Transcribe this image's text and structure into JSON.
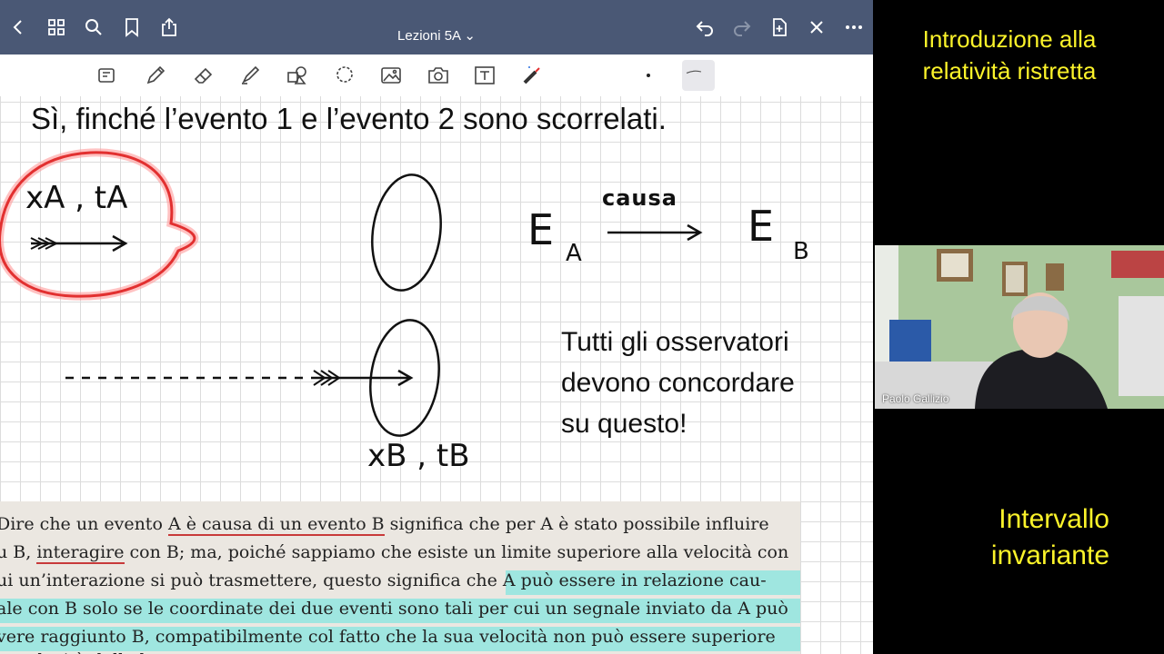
{
  "app": {
    "doc_title": "Lezioni 5A ⌄",
    "topbar_icons": [
      "back-icon",
      "grid-icon",
      "search-icon",
      "bookmark-icon",
      "share-icon",
      "undo-icon",
      "redo-icon",
      "add-page-icon",
      "close-icon",
      "more-icon"
    ],
    "tools": [
      "keyboard-icon",
      "pen-icon",
      "eraser-icon",
      "highlighter-icon",
      "shapes-icon",
      "lasso-icon",
      "image-icon",
      "camera-icon",
      "text-icon",
      "laser-pointer-icon",
      "dot-size-icon",
      "stroke-style-icon"
    ]
  },
  "page": {
    "heading": "Sì, finché l’evento 1 e l’evento 2 sono scorrelati.",
    "labels": {
      "xa_ta": "xA , tA",
      "xb_tb": "xB , tB",
      "ea": "E",
      "ea_sub": "A",
      "eb": "E",
      "eb_sub": "B",
      "causa": "causa"
    },
    "note": {
      "line1": "Tutti gli osservatori",
      "line2": "devono concordare",
      "line3": "su questo!"
    }
  },
  "book": {
    "lines": [
      {
        "a": "Dire che un evento ",
        "u": "A è causa di un evento B",
        "b": " significa che per A è stato possibile influire"
      },
      {
        "a": "u B, ",
        "u": "interagire",
        "b": " con B; ma, poiché sappiamo che esiste un limite superiore alla velocità con"
      },
      {
        "a": "ui un’interazione si può trasmettere, questo significa che A può essere in relazione cau-",
        "u": "",
        "b": ""
      },
      {
        "a": "ale con B solo se le coordinate dei due eventi sono tali per cui un segnale inviato da A può",
        "u": "",
        "b": ""
      },
      {
        "a": "vere raggiunto B, compatibilmente col fatto che la sua velocità non può essere superiore",
        "u": "",
        "b": ""
      },
      {
        "a": "la velocità della luce.",
        "u": "",
        "b": ""
      }
    ]
  },
  "sidebar": {
    "title_top_l1": "Introduzione alla",
    "title_top_l2": "relatività ristretta",
    "title_bottom_l1": "Intervallo",
    "title_bottom_l2": "invariante",
    "participant_name": "Paolo Gallizio"
  },
  "colors": {
    "topbar": "#4a5875",
    "accent_yellow": "#fbf32a",
    "highlight_cyan": "#7fe6df",
    "red_ink": "#e23030"
  }
}
